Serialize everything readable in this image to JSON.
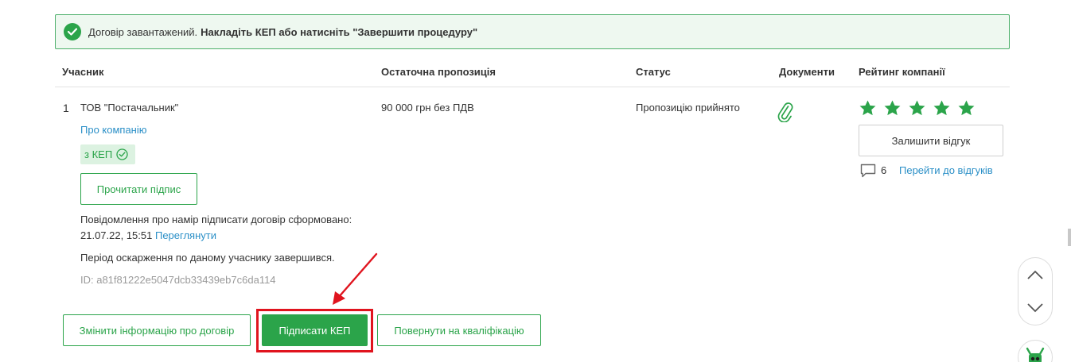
{
  "alert": {
    "text": "Договір завантажений.",
    "bold_text": "Накладіть КЕП або натисніть \"Завершити процедуру\""
  },
  "table_header": {
    "participant": "Учасник",
    "final_offer": "Остаточна пропозиція",
    "status": "Статус",
    "documents": "Документи",
    "rating": "Рейтинг компанії"
  },
  "row": {
    "number": "1",
    "company_name": "ТОВ \"Постачальник\"",
    "about_link": "Про компанію",
    "kep_badge": "з КЕП",
    "read_signature_button": "Прочитати підпис",
    "notice_line1": "Повідомлення про намір підписати договір сформовано:",
    "notice_date": "21.07.22, 15:51",
    "notice_view_link": "Переглянути",
    "appeal_text": "Період оскарження по даному учаснику завершився.",
    "id_text": "ID: a81f81222e5047dcb33439eb7c6da114",
    "offer": "90 000 грн без ПДВ",
    "status": "Пропозицію прийнято",
    "rating_stars": 5,
    "leave_review_button": "Залишити відгук",
    "review_count": "6",
    "go_to_reviews_link": "Перейти до відгуків"
  },
  "actions": {
    "change_info": "Змінити інформацію про договір",
    "sign_kep": "Підписати КЕП",
    "return_qualification": "Повернути на кваліфікацію"
  },
  "colors": {
    "accent_green": "#2ba44a",
    "link_blue": "#2a8fc7",
    "highlight_red": "#e0141e"
  }
}
